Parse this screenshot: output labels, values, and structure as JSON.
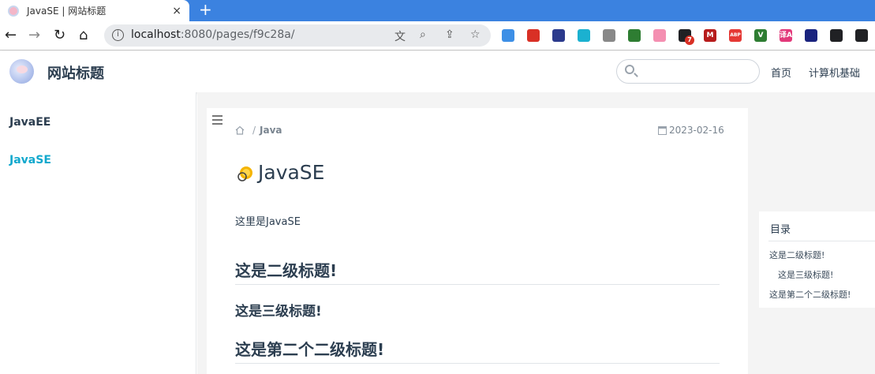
{
  "browser": {
    "tab_title": "JavaSE | 网站标题",
    "tab_close": "×",
    "new_tab": "+",
    "url_host": "localhost",
    "url_rest": ":8080/pages/f9c28a/",
    "nav": {
      "back": "←",
      "forward": "→",
      "reload": "↻",
      "home": "⌂"
    },
    "extensions": [
      {
        "icon": "ext-blue-circle-icon",
        "color": "#3d8fe6"
      },
      {
        "icon": "ext-red-dots-icon",
        "color": "#d93025"
      },
      {
        "icon": "ext-window-icon",
        "color": "#2b3a8c"
      },
      {
        "icon": "ext-filter-icon",
        "color": "#1bb1d0"
      },
      {
        "icon": "ext-copy-icon",
        "color": "#888888"
      },
      {
        "icon": "ext-download-icon",
        "color": "#2e7d32"
      },
      {
        "icon": "ext-cat-icon",
        "color": "#f48fb1"
      },
      {
        "icon": "ext-badge-icon",
        "color": "#202124",
        "badge": "7"
      },
      {
        "icon": "ext-m-icon",
        "color": "#b71c1c",
        "label": "M"
      },
      {
        "icon": "ext-abp-icon",
        "color": "#e53935",
        "label": "ABP"
      },
      {
        "icon": "ext-vue-icon",
        "color": "#2e7d32",
        "label": "V"
      },
      {
        "icon": "ext-translate-icon",
        "color": "#e2397a",
        "label": "译A"
      },
      {
        "icon": "puzzle-icon",
        "color": "#1a237e"
      },
      {
        "icon": "media-icon",
        "color": "#202124"
      },
      {
        "icon": "sidepanel-icon",
        "color": "#202124"
      }
    ]
  },
  "site": {
    "title": "网站标题",
    "search_placeholder": "",
    "nav_links": [
      "首页",
      "计算机基础"
    ]
  },
  "sidebar": {
    "items": [
      {
        "label": "JavaEE",
        "active": false
      },
      {
        "label": "JavaSE",
        "active": true
      }
    ]
  },
  "content": {
    "breadcrumb": {
      "sep": "/",
      "current": "Java"
    },
    "date": "2023-02-16",
    "title": "JavaSE",
    "paragraph": "这里是JavaSE",
    "h2_first": "这是二级标题!",
    "h3_first": "这是三级标题!",
    "h2_second": "这是第二个二级标题!"
  },
  "toc": {
    "title": "目录",
    "items": [
      "这是二级标题!",
      "这是三级标题!",
      "这是第二个二级标题!"
    ]
  },
  "colors": {
    "accent": "#11a8cd",
    "text": "#2c3e50",
    "chrome_blue": "#3b82e0"
  }
}
